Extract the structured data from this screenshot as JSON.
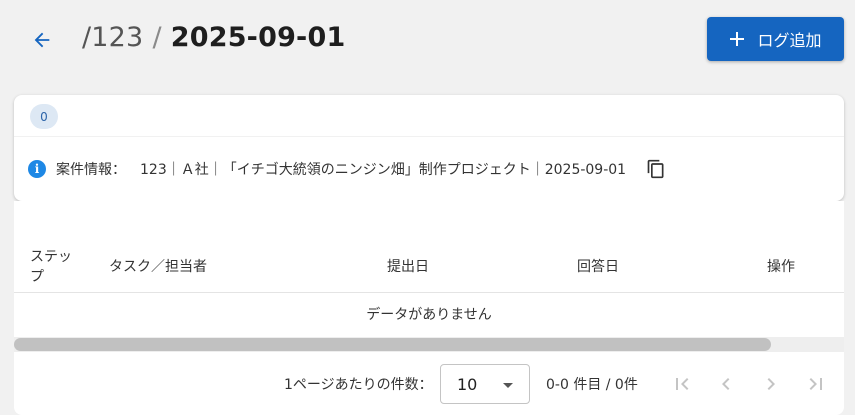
{
  "header": {
    "back_icon": "arrow-left-icon",
    "breadcrumb_project": "/123",
    "breadcrumb_separator": "/",
    "breadcrumb_current": "2025-09-01",
    "add_button": {
      "icon": "plus-icon",
      "label": "ログ追加"
    }
  },
  "info_card": {
    "badge_count": "0",
    "icon": "info-icon",
    "label": "案件情報：",
    "value": "123｜Ａ社｜「イチゴ大統領のニンジン畑」制作プロジェクト｜2025-09-01",
    "copy_icon": "copy-icon"
  },
  "table": {
    "columns": [
      "ステップ",
      "タスク／担当者",
      "提出日",
      "回答日",
      "操作"
    ],
    "empty_message": "データがありません"
  },
  "pagination": {
    "rows_per_page_label": "1ページあたりの件数：",
    "rows_per_page_value": "10",
    "range_text": "0-0 件目 / 0件",
    "buttons": [
      "first-page-icon",
      "previous-page-icon",
      "next-page-icon",
      "last-page-icon"
    ]
  },
  "colors": {
    "primary": "#1565c0",
    "info": "#1e88e5",
    "background": "#f1f1f1",
    "disabled_icon": "#c4c4c4"
  }
}
